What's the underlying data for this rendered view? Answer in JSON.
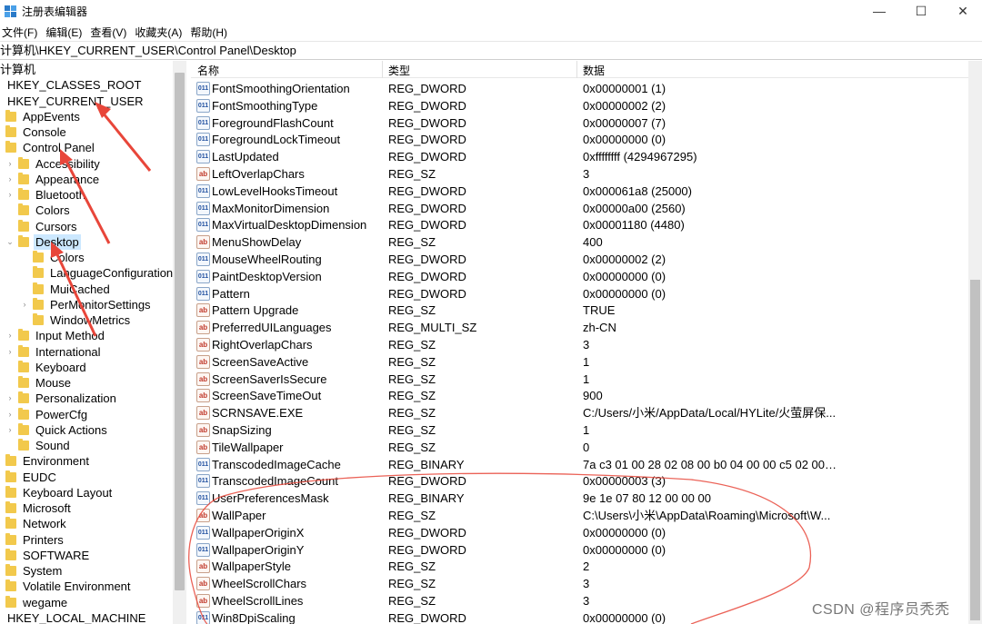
{
  "window": {
    "title": "注册表编辑器",
    "minimize_glyph": "—",
    "maximize_glyph": "☐",
    "close_glyph": "✕"
  },
  "menu": [
    "文件(F)",
    "编辑(E)",
    "查看(V)",
    "收藏夹(A)",
    "帮助(H)"
  ],
  "address": "计算机\\HKEY_CURRENT_USER\\Control Panel\\Desktop",
  "tree": [
    {
      "label": "计算机",
      "indent": 0,
      "expander": "",
      "folder": false
    },
    {
      "label": "HKEY_CLASSES_ROOT",
      "indent": 1,
      "expander": "",
      "folder": false
    },
    {
      "label": "HKEY_CURRENT_USER",
      "indent": 1,
      "expander": "",
      "folder": false
    },
    {
      "label": "AppEvents",
      "indent": 2,
      "expander": "",
      "folder": true
    },
    {
      "label": "Console",
      "indent": 2,
      "expander": "",
      "folder": true
    },
    {
      "label": "Control Panel",
      "indent": 2,
      "expander": "",
      "folder": true
    },
    {
      "label": "Accessibility",
      "indent": 3,
      "expander": ">",
      "folder": true
    },
    {
      "label": "Appearance",
      "indent": 3,
      "expander": ">",
      "folder": true
    },
    {
      "label": "Bluetooth",
      "indent": 3,
      "expander": ">",
      "folder": true
    },
    {
      "label": "Colors",
      "indent": 3,
      "expander": "",
      "folder": true
    },
    {
      "label": "Cursors",
      "indent": 3,
      "expander": "",
      "folder": true
    },
    {
      "label": "Desktop",
      "indent": 3,
      "expander": "v",
      "folder": true,
      "selected": true
    },
    {
      "label": "Colors",
      "indent": 4,
      "expander": "",
      "folder": true
    },
    {
      "label": "LanguageConfiguration",
      "indent": 4,
      "expander": "",
      "folder": true
    },
    {
      "label": "MuiCached",
      "indent": 4,
      "expander": "",
      "folder": true
    },
    {
      "label": "PerMonitorSettings",
      "indent": 4,
      "expander": ">",
      "folder": true
    },
    {
      "label": "WindowMetrics",
      "indent": 4,
      "expander": "",
      "folder": true
    },
    {
      "label": "Input Method",
      "indent": 3,
      "expander": ">",
      "folder": true
    },
    {
      "label": "International",
      "indent": 3,
      "expander": ">",
      "folder": true
    },
    {
      "label": "Keyboard",
      "indent": 3,
      "expander": "",
      "folder": true
    },
    {
      "label": "Mouse",
      "indent": 3,
      "expander": "",
      "folder": true
    },
    {
      "label": "Personalization",
      "indent": 3,
      "expander": ">",
      "folder": true
    },
    {
      "label": "PowerCfg",
      "indent": 3,
      "expander": ">",
      "folder": true
    },
    {
      "label": "Quick Actions",
      "indent": 3,
      "expander": ">",
      "folder": true
    },
    {
      "label": "Sound",
      "indent": 3,
      "expander": "",
      "folder": true
    },
    {
      "label": "Environment",
      "indent": 2,
      "expander": "",
      "folder": true
    },
    {
      "label": "EUDC",
      "indent": 2,
      "expander": "",
      "folder": true
    },
    {
      "label": "Keyboard Layout",
      "indent": 2,
      "expander": "",
      "folder": true
    },
    {
      "label": "Microsoft",
      "indent": 2,
      "expander": "",
      "folder": true
    },
    {
      "label": "Network",
      "indent": 2,
      "expander": "",
      "folder": true
    },
    {
      "label": "Printers",
      "indent": 2,
      "expander": "",
      "folder": true
    },
    {
      "label": "SOFTWARE",
      "indent": 2,
      "expander": "",
      "folder": true
    },
    {
      "label": "System",
      "indent": 2,
      "expander": "",
      "folder": true
    },
    {
      "label": "Volatile Environment",
      "indent": 2,
      "expander": "",
      "folder": true
    },
    {
      "label": "wegame",
      "indent": 2,
      "expander": "",
      "folder": true
    },
    {
      "label": "HKEY_LOCAL_MACHINE",
      "indent": 1,
      "expander": "",
      "folder": false
    }
  ],
  "columns": {
    "name": "名称",
    "type": "类型",
    "data": "数据"
  },
  "values": [
    {
      "name": "FontSmoothingOrientation",
      "type": "REG_DWORD",
      "data": "0x00000001 (1)",
      "icon": "dword"
    },
    {
      "name": "FontSmoothingType",
      "type": "REG_DWORD",
      "data": "0x00000002 (2)",
      "icon": "dword"
    },
    {
      "name": "ForegroundFlashCount",
      "type": "REG_DWORD",
      "data": "0x00000007 (7)",
      "icon": "dword"
    },
    {
      "name": "ForegroundLockTimeout",
      "type": "REG_DWORD",
      "data": "0x00000000 (0)",
      "icon": "dword"
    },
    {
      "name": "LastUpdated",
      "type": "REG_DWORD",
      "data": "0xffffffff (4294967295)",
      "icon": "dword"
    },
    {
      "name": "LeftOverlapChars",
      "type": "REG_SZ",
      "data": "3",
      "icon": "sz"
    },
    {
      "name": "LowLevelHooksTimeout",
      "type": "REG_DWORD",
      "data": "0x000061a8 (25000)",
      "icon": "dword"
    },
    {
      "name": "MaxMonitorDimension",
      "type": "REG_DWORD",
      "data": "0x00000a00 (2560)",
      "icon": "dword"
    },
    {
      "name": "MaxVirtualDesktopDimension",
      "type": "REG_DWORD",
      "data": "0x00001180 (4480)",
      "icon": "dword"
    },
    {
      "name": "MenuShowDelay",
      "type": "REG_SZ",
      "data": "400",
      "icon": "sz"
    },
    {
      "name": "MouseWheelRouting",
      "type": "REG_DWORD",
      "data": "0x00000002 (2)",
      "icon": "dword"
    },
    {
      "name": "PaintDesktopVersion",
      "type": "REG_DWORD",
      "data": "0x00000000 (0)",
      "icon": "dword"
    },
    {
      "name": "Pattern",
      "type": "REG_DWORD",
      "data": "0x00000000 (0)",
      "icon": "dword"
    },
    {
      "name": "Pattern Upgrade",
      "type": "REG_SZ",
      "data": "TRUE",
      "icon": "sz"
    },
    {
      "name": "PreferredUILanguages",
      "type": "REG_MULTI_SZ",
      "data": "zh-CN",
      "icon": "sz"
    },
    {
      "name": "RightOverlapChars",
      "type": "REG_SZ",
      "data": "3",
      "icon": "sz"
    },
    {
      "name": "ScreenSaveActive",
      "type": "REG_SZ",
      "data": "1",
      "icon": "sz"
    },
    {
      "name": "ScreenSaverIsSecure",
      "type": "REG_SZ",
      "data": "1",
      "icon": "sz"
    },
    {
      "name": "ScreenSaveTimeOut",
      "type": "REG_SZ",
      "data": "900",
      "icon": "sz"
    },
    {
      "name": "SCRNSAVE.EXE",
      "type": "REG_SZ",
      "data": "C:/Users/小米/AppData/Local/HYLite/火萤屏保...",
      "icon": "sz"
    },
    {
      "name": "SnapSizing",
      "type": "REG_SZ",
      "data": "1",
      "icon": "sz"
    },
    {
      "name": "TileWallpaper",
      "type": "REG_SZ",
      "data": "0",
      "icon": "sz"
    },
    {
      "name": "TranscodedImageCache",
      "type": "REG_BINARY",
      "data": "7a c3 01 00 28 02 08 00 b0 04 00 00 c5 02 00 ...",
      "icon": "dword"
    },
    {
      "name": "TranscodedImageCount",
      "type": "REG_DWORD",
      "data": "0x00000003 (3)",
      "icon": "dword"
    },
    {
      "name": "UserPreferencesMask",
      "type": "REG_BINARY",
      "data": "9e 1e 07 80 12 00 00 00",
      "icon": "dword"
    },
    {
      "name": "WallPaper",
      "type": "REG_SZ",
      "data": "C:\\Users\\小米\\AppData\\Roaming\\Microsoft\\W...",
      "icon": "sz"
    },
    {
      "name": "WallpaperOriginX",
      "type": "REG_DWORD",
      "data": "0x00000000 (0)",
      "icon": "dword"
    },
    {
      "name": "WallpaperOriginY",
      "type": "REG_DWORD",
      "data": "0x00000000 (0)",
      "icon": "dword"
    },
    {
      "name": "WallpaperStyle",
      "type": "REG_SZ",
      "data": "2",
      "icon": "sz"
    },
    {
      "name": "WheelScrollChars",
      "type": "REG_SZ",
      "data": "3",
      "icon": "sz"
    },
    {
      "name": "WheelScrollLines",
      "type": "REG_SZ",
      "data": "3",
      "icon": "sz"
    },
    {
      "name": "Win8DpiScaling",
      "type": "REG_DWORD",
      "data": "0x00000000 (0)",
      "icon": "dword"
    }
  ],
  "icon_glyphs": {
    "dword": "011\n110",
    "sz": "ab"
  },
  "watermark": "CSDN @程序员秃秃",
  "colors": {
    "annotation_red": "#e8463a",
    "selection": "#cce8ff",
    "folder": "#f2c94c"
  }
}
